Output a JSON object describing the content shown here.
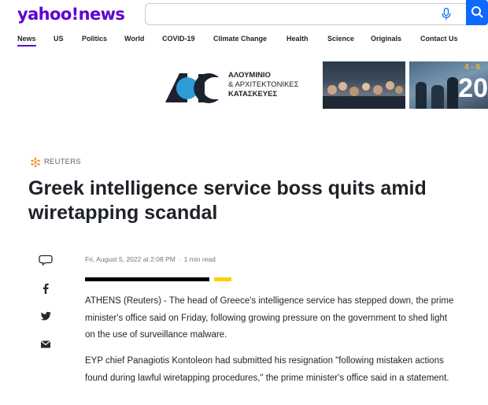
{
  "header": {
    "logo_text": "yahoo!news",
    "search_placeholder": "",
    "icons": [
      "mic-icon",
      "search-icon"
    ],
    "brand_color": "#6001d2",
    "search_button_color": "#0f69ff"
  },
  "nav": {
    "items": [
      "News",
      "US",
      "Politics",
      "World",
      "COVID-19",
      "Climate Change",
      "Health",
      "Science",
      "Originals",
      "Contact Us"
    ],
    "active": "News"
  },
  "ad": {
    "line1": "ΑΛΟΥΜΙΝΙΟ",
    "line2": "& ΑΡΧΙΤΕΚΤΟΝΙΚΕΣ",
    "line3": "ΚΑΤΑΣΚΕΥΕΣ",
    "date": "4 - 6",
    "year": "20"
  },
  "article": {
    "source": "REUTERS",
    "title": "Greek intelligence service boss quits amid wiretapping scandal",
    "date": "Fri, August 5, 2022 at 2:08 PM",
    "separator": "·",
    "read_time": "1 min read",
    "share_icons": [
      "comment-icon",
      "facebook-icon",
      "twitter-icon",
      "email-icon"
    ],
    "paragraphs": [
      "ATHENS (Reuters) - The head of Greece's intelligence service has stepped down, the prime minister's office said on Friday, following growing pressure on the government to shed light on the use of surveillance malware.",
      "EYP chief Panagiotis Kontoleon had submitted his resignation \"following mistaken actions found during lawful wiretapping procedures,\" the prime minister's office said in a statement."
    ]
  }
}
